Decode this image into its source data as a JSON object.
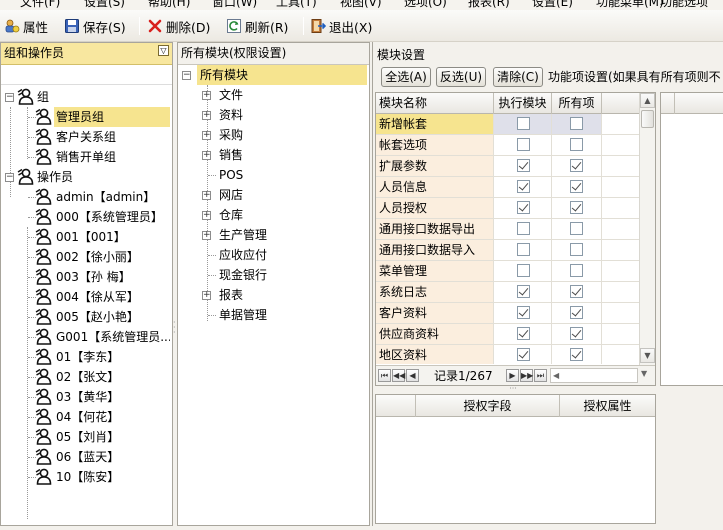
{
  "menubar": {
    "items": [
      "文件(F)",
      "设置(S)",
      "帮助(H)",
      "窗口(W)",
      "工具(T)",
      "视图(V)",
      "选项(O)",
      "报表(R)",
      "设置(E)",
      "功能菜单(M)",
      "功能选项"
    ]
  },
  "toolbar": {
    "properties": "属性",
    "save": "保存(S)",
    "delete": "删除(D)",
    "refresh": "刷新(R)",
    "exit": "退出(X)"
  },
  "left_panel": {
    "title": "组和操作员",
    "groups_label": "组",
    "groups": [
      "管理员组",
      "客户关系组",
      "销售开单组"
    ],
    "operators_label": "操作员",
    "operators": [
      "admin【admin】",
      "000【系统管理员】",
      "001【001】",
      "002【徐小丽】",
      "003【孙 梅】",
      "004【徐从军】",
      "005【赵小艳】",
      "G001【系统管理员...",
      "01【李东】",
      "02【张文】",
      "03【黄华】",
      "04【何花】",
      "05【刘肖】",
      "06【蓝天】",
      "10【陈安】"
    ]
  },
  "middle_panel": {
    "title": "所有模块(权限设置)",
    "root": "所有模块",
    "modules": [
      {
        "label": "文件",
        "expandable": true
      },
      {
        "label": "资料",
        "expandable": true
      },
      {
        "label": "采购",
        "expandable": true
      },
      {
        "label": "销售",
        "expandable": true
      },
      {
        "label": "POS",
        "expandable": false
      },
      {
        "label": "网店",
        "expandable": true
      },
      {
        "label": "仓库",
        "expandable": true
      },
      {
        "label": "生产管理",
        "expandable": true
      },
      {
        "label": "应收应付",
        "expandable": false
      },
      {
        "label": "现金银行",
        "expandable": false
      },
      {
        "label": "报表",
        "expandable": true
      },
      {
        "label": "单据管理",
        "expandable": false
      }
    ]
  },
  "right_panel": {
    "title": "模块设置",
    "select_all": "全选(A)",
    "invert": "反选(U)",
    "clear": "清除(C)",
    "function_settings": "功能项设置(如果具有所有项则不",
    "columns": [
      "模块名称",
      "执行模块",
      "所有项"
    ],
    "rows": [
      {
        "name": "新增帐套",
        "exec": false,
        "all": false
      },
      {
        "name": "帐套选项",
        "exec": false,
        "all": false
      },
      {
        "name": "扩展参数",
        "exec": true,
        "all": true
      },
      {
        "name": "人员信息",
        "exec": true,
        "all": true
      },
      {
        "name": "人员授权",
        "exec": true,
        "all": true
      },
      {
        "name": "通用接口数据导出",
        "exec": false,
        "all": false
      },
      {
        "name": "通用接口数据导入",
        "exec": false,
        "all": false
      },
      {
        "name": "菜单管理",
        "exec": false,
        "all": false
      },
      {
        "name": "系统日志",
        "exec": true,
        "all": true
      },
      {
        "name": "客户资料",
        "exec": true,
        "all": true
      },
      {
        "name": "供应商资料",
        "exec": true,
        "all": true
      },
      {
        "name": "地区资料",
        "exec": true,
        "all": true
      }
    ],
    "record_label": "记录1/267",
    "auth_columns": [
      "授权字段",
      "授权属性"
    ]
  },
  "colors": {
    "selection": "#f6e48f",
    "row_name_bg": "#fbeede",
    "header_bg": "#f8e79f"
  }
}
